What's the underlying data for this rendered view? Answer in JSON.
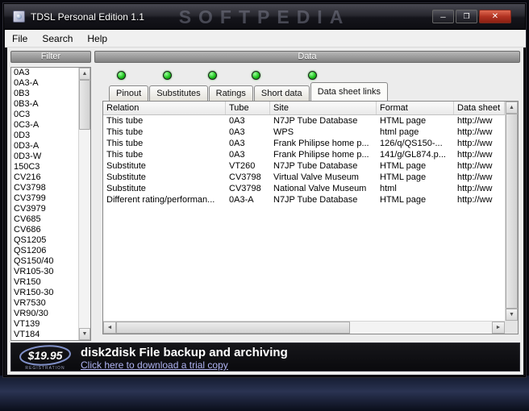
{
  "window": {
    "title": "TDSL Personal Edition 1.1",
    "watermark": "SOFTPEDIA",
    "controls": {
      "minimize": "─",
      "maximize": "❐",
      "close": "✕"
    }
  },
  "menu": {
    "items": [
      "File",
      "Search",
      "Help"
    ]
  },
  "filter": {
    "header": "Filter",
    "items": [
      "0A3",
      "0A3-A",
      "0B3",
      "0B3-A",
      "0C3",
      "0C3-A",
      "0D3",
      "0D3-A",
      "0D3-W",
      "150C3",
      "CV216",
      "CV3798",
      "CV3799",
      "CV3979",
      "CV685",
      "CV686",
      "QS1205",
      "QS1206",
      "QS150/40",
      "VR105-30",
      "VR150",
      "VR150-30",
      "VR7530",
      "VR90/30",
      "VT139",
      "VT184"
    ]
  },
  "data": {
    "header": "Data",
    "tabs": [
      "Pinout",
      "Substitutes",
      "Ratings",
      "Short data",
      "Data sheet links"
    ],
    "active_tab": "Data sheet links",
    "led_count": 5,
    "table": {
      "columns": [
        "Relation",
        "Tube",
        "Site",
        "Format",
        "Data sheet"
      ],
      "rows": [
        [
          "This tube",
          "0A3",
          "N7JP Tube Database",
          "HTML page",
          "http://ww"
        ],
        [
          "This tube",
          "0A3",
          "WPS",
          "html page",
          "http://ww"
        ],
        [
          "This tube",
          "0A3",
          "Frank Philipse home p...",
          "126/q/QS150-...",
          "http://ww"
        ],
        [
          "This tube",
          "0A3",
          "Frank Philipse home p...",
          "141/g/GL874.p...",
          "http://ww"
        ],
        [
          "Substitute",
          "VT260",
          "N7JP Tube Database",
          "HTML page",
          "http://ww"
        ],
        [
          "Substitute",
          "CV3798",
          "Virtual Valve Museum",
          "HTML page",
          "http://ww"
        ],
        [
          "Substitute",
          "CV3798",
          "National Valve Museum",
          "html",
          "http://ww"
        ],
        [
          "Different rating/performan...",
          "0A3-A",
          "N7JP Tube Database",
          "HTML page",
          "http://ww"
        ]
      ]
    }
  },
  "scrollbar": {
    "up": "▲",
    "down": "▼",
    "left": "◄",
    "right": "►"
  },
  "banner": {
    "price": "$19.95",
    "price_sub": "REGISTRATION",
    "title": "disk2disk File backup and archiving",
    "link": "Click here to download a trial copy"
  },
  "colors": {
    "led_green": "#1ec51e",
    "close_button_red": "#b23322",
    "banner_link": "#b0b4f4",
    "title_text": "#ffffff"
  }
}
